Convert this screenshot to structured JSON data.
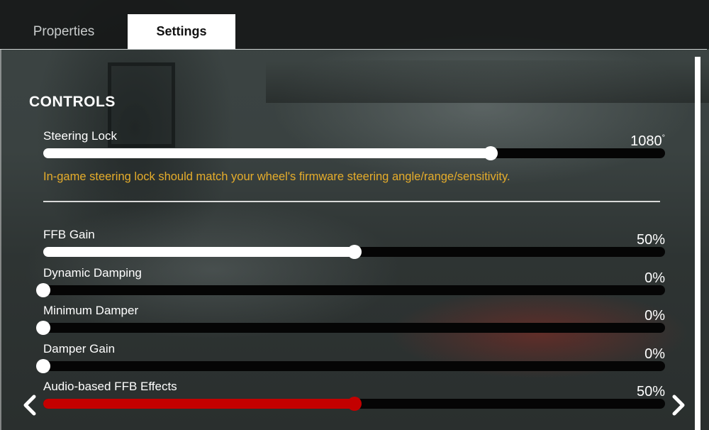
{
  "tabs": [
    {
      "label": "Properties",
      "active": false
    },
    {
      "label": "Settings",
      "active": true
    }
  ],
  "section": {
    "title": "CONTROLS"
  },
  "steering": {
    "label": "Steering Lock",
    "value": "1080",
    "unit": "°",
    "fraction": 0.72,
    "hint": "In-game steering lock should match your wheel's firmware steering angle/range/sensitivity."
  },
  "sliders": [
    {
      "label": "FFB Gain",
      "value": "50%",
      "fraction": 0.5,
      "color": "#ffffff"
    },
    {
      "label": "Dynamic Damping",
      "value": "0%",
      "fraction": 0.0,
      "color": "#ffffff"
    },
    {
      "label": "Minimum Damper",
      "value": "0%",
      "fraction": 0.0,
      "color": "#ffffff"
    },
    {
      "label": "Damper Gain",
      "value": "0%",
      "fraction": 0.0,
      "color": "#ffffff"
    },
    {
      "label": "Audio-based FFB Effects",
      "value": "50%",
      "fraction": 0.5,
      "color": "#c30000"
    }
  ],
  "nav": {
    "prev_icon": "chevron-left-icon",
    "next_icon": "chevron-right-icon"
  },
  "colors": {
    "accent_red": "#c30000",
    "hint_text": "#e6ad2b"
  }
}
